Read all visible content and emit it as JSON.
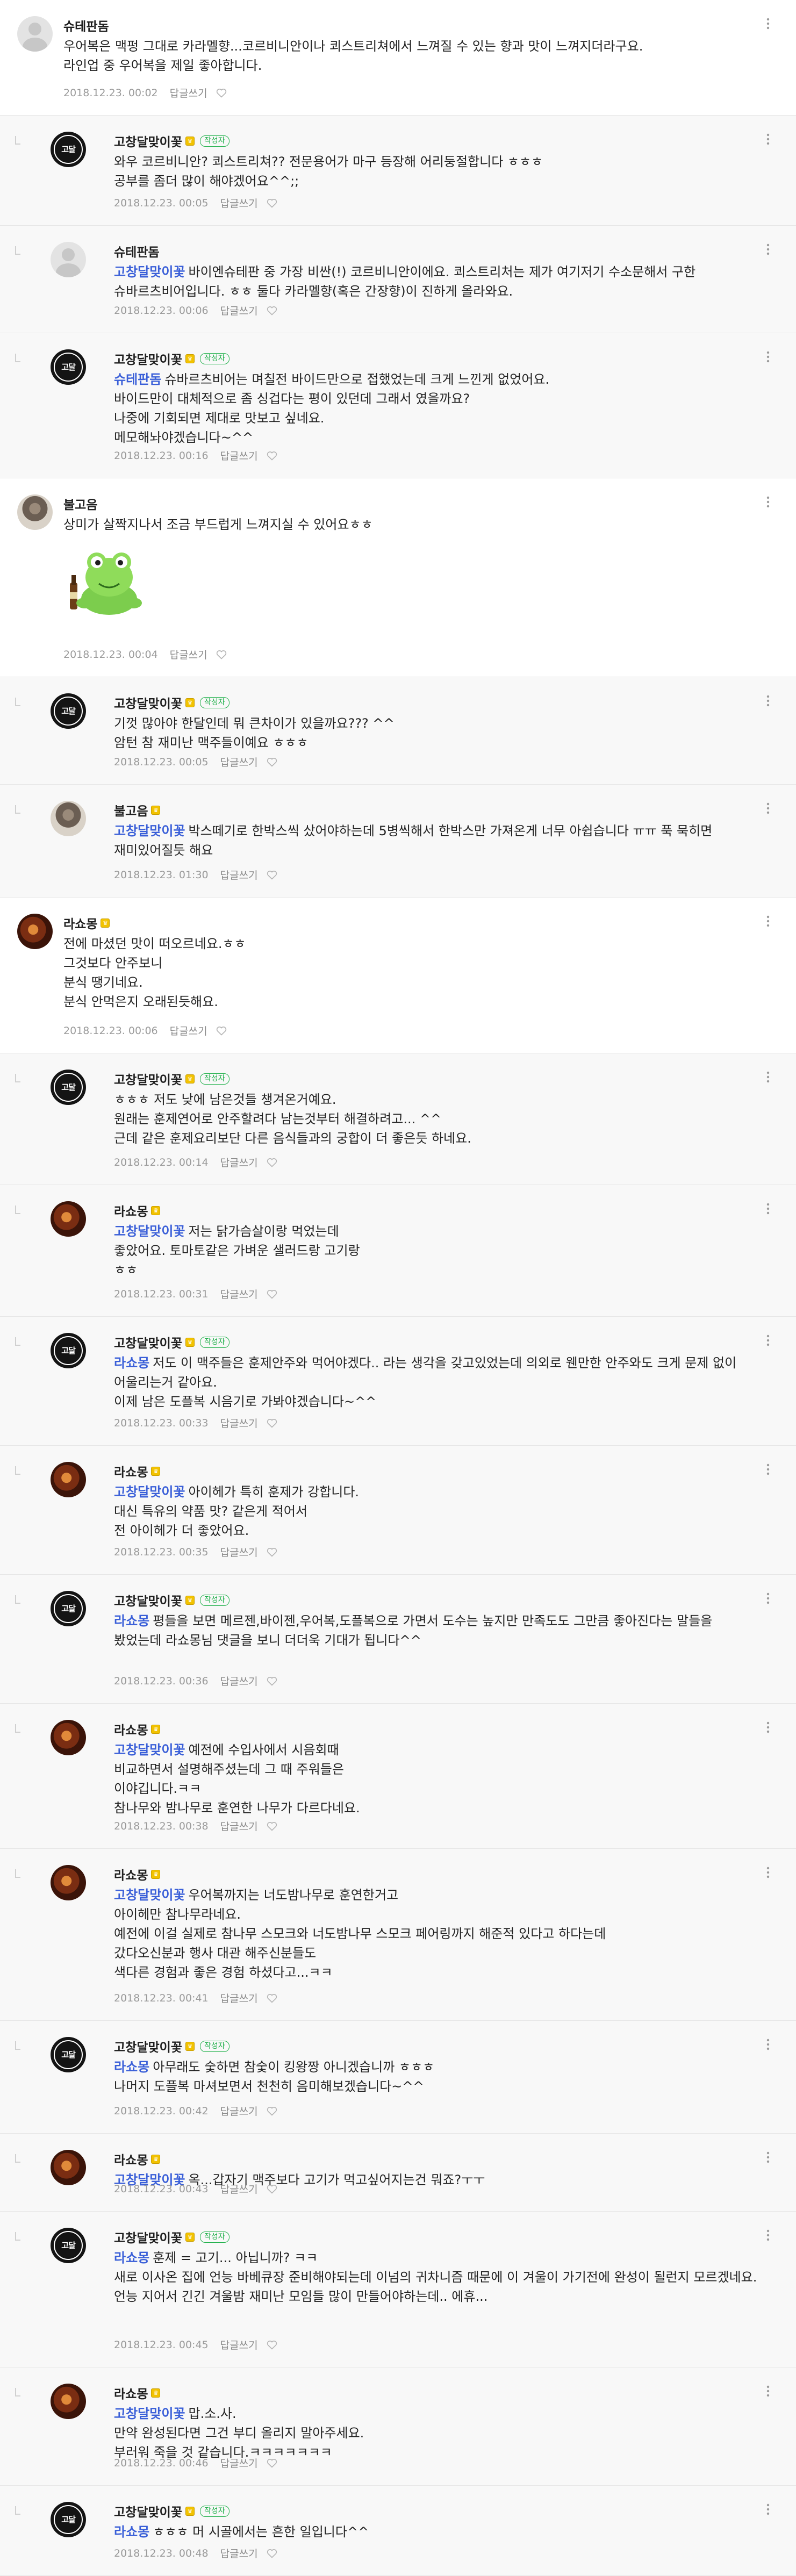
{
  "ui": {
    "reply_label": "답글쓰기",
    "writer_tag": "작성자",
    "badge_glyph": "♛",
    "like_icon": "heart-outline-icon",
    "more_icon": "vertical-ellipsis-icon",
    "mention_color": "#3a5fd8",
    "writer_tag_color": "#22b14c",
    "badge_color": "#f2c200"
  },
  "comments": [
    {
      "author": "슈테판돔",
      "avatar": "default-profile",
      "reply": false,
      "writer": false,
      "badge": false,
      "mention": "",
      "text": "우어복은 맥펑 그대로 카라멜향...코르비니안이나 쾨스트리쳐에서 느껴질 수 있는 향과 맛이 느껴지더라구요.\n라인업 중 우어복을 제일 좋아합니다.",
      "date": "2018.12.23. 00:02"
    },
    {
      "author": "고창달맞이꽃",
      "avatar": "writer-logo",
      "reply": true,
      "writer": true,
      "badge": true,
      "mention": "",
      "text": "와우 코르비니안? 쾨스트리쳐?? 전문용어가 마구 등장해 어리둥절합니다 ㅎㅎㅎ\n공부를 좀더 많이 해야겠어요^^;;",
      "date": "2018.12.23. 00:05"
    },
    {
      "author": "슈테판돔",
      "avatar": "default-profile",
      "reply": true,
      "writer": false,
      "badge": false,
      "mention": "고창달맞이꽃",
      "text": "바이엔슈테판 중 가장 비싼(!) 코르비니안이에요. 쾨스트리처는 제가 여기저기 수소문해서 구한 슈바르츠비어입니다. ㅎㅎ 둘다 카라멜향(혹은 간장향)이 진하게 올라와요.",
      "date": "2018.12.23. 00:06"
    },
    {
      "author": "고창달맞이꽃",
      "avatar": "writer-logo",
      "reply": true,
      "writer": true,
      "badge": true,
      "mention": "슈테판돔",
      "text": "슈바르츠비어는 며칠전 바이드만으로 접했었는데 크게 느낀게 없었어요.\n바이드만이 대체적으로 좀 싱겁다는 평이 있던데 그래서 였을까요?\n나중에 기회되면 제대로 맛보고 싶네요.\n메모해놔야겠습니다~^^",
      "date": "2018.12.23. 00:16"
    },
    {
      "author": "불고음",
      "avatar": "cat-photo",
      "reply": false,
      "writer": false,
      "badge": false,
      "mention": "",
      "text": "상미가 살짝지나서 조금 부드럽게 느껴지실 수 있어요ㅎㅎ",
      "date": "2018.12.23. 00:04",
      "sticker": "frog-beer-sticker"
    },
    {
      "author": "고창달맞이꽃",
      "avatar": "writer-logo",
      "reply": true,
      "writer": true,
      "badge": true,
      "mention": "",
      "text": "기껏 많아야 한달인데 뭐 큰차이가 있을까요??? ^^\n암턴 참 재미난 맥주들이예요 ㅎㅎㅎ",
      "date": "2018.12.23. 00:05"
    },
    {
      "author": "불고음",
      "avatar": "cat-photo",
      "reply": true,
      "writer": false,
      "badge": true,
      "mention": "고창달맞이꽃",
      "text": "박스떼기로 한박스씩 샀어야하는데 5병씩해서 한박스만 가져온게 너무 아쉽습니다 ㅠㅠ 푹 묵히면 재미있어질듯 해요",
      "date": "2018.12.23. 01:30"
    },
    {
      "author": "라쇼몽",
      "avatar": "food-photo",
      "reply": false,
      "writer": false,
      "badge": true,
      "mention": "",
      "text": "전에 마셨던 맛이 떠오르네요.ㅎㅎ\n그것보다 안주보니\n분식 땡기네요.\n분식 안먹은지 오래된듯해요.",
      "date": "2018.12.23. 00:06"
    },
    {
      "author": "고창달맞이꽃",
      "avatar": "writer-logo",
      "reply": true,
      "writer": true,
      "badge": true,
      "mention": "",
      "text": "ㅎㅎㅎ 저도 낮에 남은것들 챙겨온거예요.\n원래는 훈제연어로 안주할려다 남는것부터 해결하려고... ^^\n근데 같은 훈제요리보단 다른 음식들과의 궁합이 더 좋은듯 하네요.",
      "date": "2018.12.23. 00:14"
    },
    {
      "author": "라쇼몽",
      "avatar": "food-photo",
      "reply": true,
      "writer": false,
      "badge": true,
      "mention": "고창달맞이꽃",
      "text": "저는 닭가슴살이랑 먹었는데\n좋았어요. 토마토같은 가벼운 샐러드랑 고기랑\nㅎㅎ",
      "date": "2018.12.23. 00:31"
    },
    {
      "author": "고창달맞이꽃",
      "avatar": "writer-logo",
      "reply": true,
      "writer": true,
      "badge": true,
      "mention": "라쇼몽",
      "text": "저도 이 맥주들은 훈제안주와 먹어야겠다.. 라는 생각을 갖고있었는데 의외로 웬만한 안주와도 크게 문제 없이 어울리는거 같아요.\n이제 남은 도플복 시음기로 가봐야겠습니다~^^",
      "date": "2018.12.23. 00:33"
    },
    {
      "author": "라쇼몽",
      "avatar": "food-photo",
      "reply": true,
      "writer": false,
      "badge": true,
      "mention": "고창달맞이꽃",
      "text": "아이헤가 특히 훈제가 강합니다.\n대신 특유의 약품 맛? 같은게 적어서\n전 아이헤가 더 좋았어요.",
      "date": "2018.12.23. 00:35"
    },
    {
      "author": "고창달맞이꽃",
      "avatar": "writer-logo",
      "reply": true,
      "writer": true,
      "badge": true,
      "mention": "라쇼몽",
      "text": "평들을 보면 메르젠,바이젠,우어복,도플복으로 가면서 도수는 높지만 만족도도 그만큼 좋아진다는 말들을 봤었는데 라쇼몽님 댓글을 보니 더더욱 기대가 됩니다^^",
      "date": "2018.12.23. 00:36"
    },
    {
      "author": "라쇼몽",
      "avatar": "food-photo",
      "reply": true,
      "writer": false,
      "badge": true,
      "mention": "고창달맞이꽃",
      "text": "예전에 수입사에서 시음회때\n비교하면서 설명해주셨는데 그 때 주워들은\n이야깁니다.ㅋㅋ\n참나무와 밤나무로 훈연한 나무가 다르다네요.",
      "date": "2018.12.23. 00:38"
    },
    {
      "author": "라쇼몽",
      "avatar": "food-photo",
      "reply": true,
      "writer": false,
      "badge": true,
      "mention": "고창달맞이꽃",
      "text": "우어복까지는 너도밤나무로 훈연한거고\n아이헤만 참나무라네요.\n예전에 이걸 실제로 참나무 스모크와 너도밤나무 스모크 페어링까지 해준적 있다고 하다는데\n갔다오신분과 행사 대관 해주신분들도\n색다른 경험과 좋은 경험 하셨다고...ㅋㅋ",
      "date": "2018.12.23. 00:41"
    },
    {
      "author": "고창달맞이꽃",
      "avatar": "writer-logo",
      "reply": true,
      "writer": true,
      "badge": true,
      "mention": "라쇼몽",
      "text": "아무래도 숯하면 참숯이 킹왕짱 아니겠습니까 ㅎㅎㅎ\n나머지 도플복 마셔보면서 천천히 음미해보겠습니다~^^",
      "date": "2018.12.23. 00:42"
    },
    {
      "author": "라쇼몽",
      "avatar": "food-photo",
      "reply": true,
      "writer": false,
      "badge": true,
      "mention": "고창달맞이꽃",
      "text": "옥...갑자기 맥주보다 고기가 먹고싶어지는건 뭐죠?ㅜㅜ",
      "date": "2018.12.23. 00:43"
    },
    {
      "author": "고창달맞이꽃",
      "avatar": "writer-logo",
      "reply": true,
      "writer": true,
      "badge": true,
      "mention": "라쇼몽",
      "text": "훈제 = 고기... 아닙니까? ㅋㅋ\n새로 이사온 집에 언능 바베큐장 준비해야되는데 이넘의 귀차니즘 때문에 이 겨울이 가기전에 완성이 될런지 모르겠네요.\n언능 지어서 긴긴 겨울밤 재미난 모임들 많이 만들어야하는데.. 에휴...",
      "date": "2018.12.23. 00:45"
    },
    {
      "author": "라쇼몽",
      "avatar": "food-photo",
      "reply": true,
      "writer": false,
      "badge": true,
      "mention": "고창달맞이꽃",
      "text": "맙.소.사.\n만약 완성된다면 그건 부디 올리지 말아주세요.\n부러워 죽을 것 같습니다.ㅋㅋㅋㅋㅋㅋㅋ",
      "date": "2018.12.23. 00:46"
    },
    {
      "author": "고창달맞이꽃",
      "avatar": "writer-logo",
      "reply": true,
      "writer": true,
      "badge": true,
      "mention": "라쇼몽",
      "text": "ㅎㅎㅎ 머 시골에서는 흔한 일입니다^^",
      "date": "2018.12.23. 00:48"
    }
  ]
}
